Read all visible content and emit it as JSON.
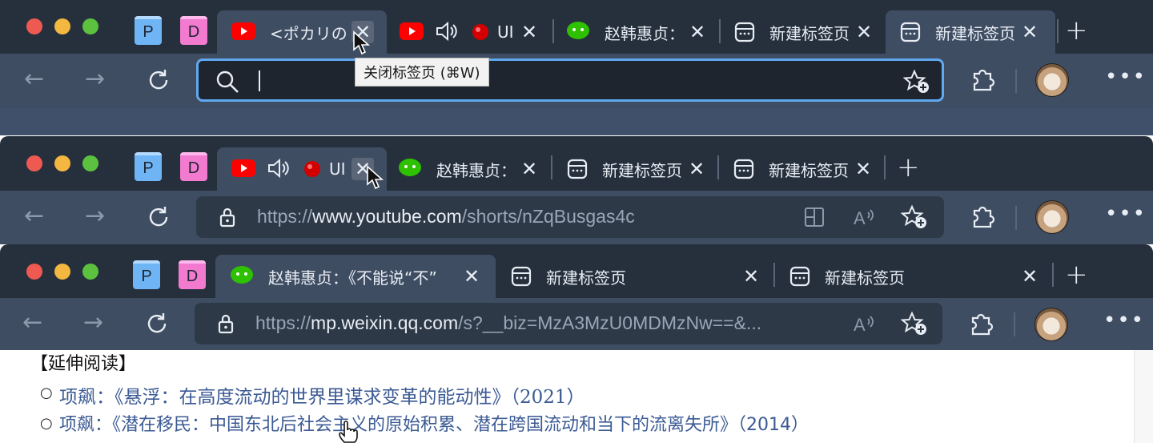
{
  "pinned": [
    {
      "label": "P"
    },
    {
      "label": "D"
    }
  ],
  "window1": {
    "tabs": [
      {
        "title": "<ポカリの",
        "type": "youtube"
      },
      {
        "title": "UI",
        "type": "youtube-audio"
      },
      {
        "title": "赵韩惠贞：",
        "type": "wechat"
      },
      {
        "title": "新建标签页",
        "type": "newtab"
      },
      {
        "title": "新建标签页",
        "type": "newtab"
      }
    ],
    "tooltip": "关闭标签页 (⌘W)",
    "omnibox_value": ""
  },
  "window2": {
    "tabs": [
      {
        "title": "UI",
        "type": "youtube-audio"
      },
      {
        "title": "赵韩惠贞：",
        "type": "wechat"
      },
      {
        "title": "新建标签页",
        "type": "newtab"
      },
      {
        "title": "新建标签页",
        "type": "newtab"
      }
    ],
    "url_prefix": "https://",
    "url_host": "www.youtube.com",
    "url_path": "/shorts/nZqBusgas4c"
  },
  "window3": {
    "tabs": [
      {
        "title": "赵韩惠贞：《不能说“不”",
        "type": "wechat"
      },
      {
        "title": "新建标签页",
        "type": "newtab"
      },
      {
        "title": "新建标签页",
        "type": "newtab"
      }
    ],
    "url_prefix": "https://",
    "url_host": "mp.weixin.qq.com",
    "url_path": "/s?__biz=MzA3MzU0MDMzNw==&..."
  },
  "content": {
    "heading": "【延伸阅读】",
    "items": [
      {
        "text": "项飙：《悬浮：在高度流动的世界里谋求变革的能动性》（2021）"
      },
      {
        "text": "项飙：《潜在移民：中国东北后社会主义的原始积累、潜在跨国流动和当下的流离失所》（2014）"
      }
    ]
  },
  "colors": {
    "tabbar": "#26303d",
    "toolbar": "#3f4d63",
    "link": "#3b5a94",
    "focus": "#5fa9f0"
  }
}
